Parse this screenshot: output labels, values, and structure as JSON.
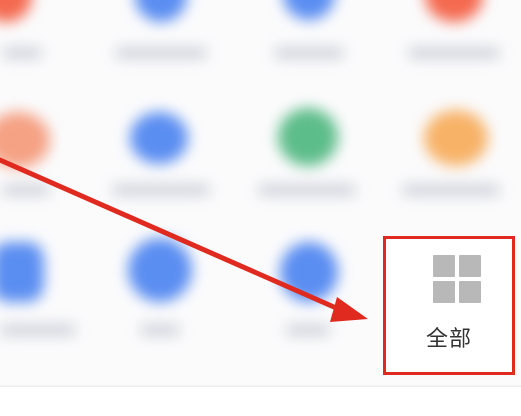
{
  "launcher": {
    "all_button": {
      "label": "全部",
      "icon": "four-squares-grid-icon"
    }
  },
  "annotation": {
    "highlight_color": "#e0291f",
    "arrow_color": "#e0291f"
  },
  "colors": {
    "background": "#fbfbfc",
    "grid_icon": "#b8b8b8",
    "label_text": "#333333"
  }
}
